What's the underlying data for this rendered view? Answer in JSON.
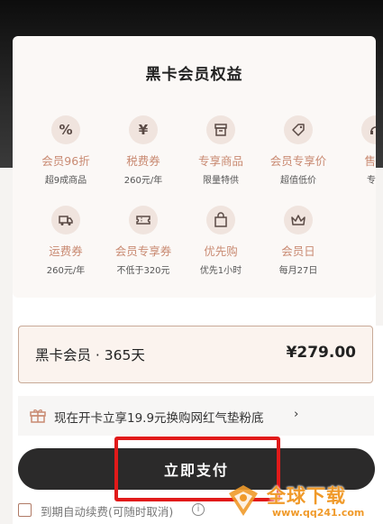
{
  "card": {
    "title": "黑卡会员权益",
    "benefits_row1": [
      {
        "icon": "percent-icon",
        "glyph": "%",
        "name": "会员96折",
        "sub": "超9成商品"
      },
      {
        "icon": "yen-icon",
        "glyph": "¥",
        "name": "税费券",
        "sub": "260元/年"
      },
      {
        "icon": "box-icon",
        "name": "专享商品",
        "sub": "限量特供"
      },
      {
        "icon": "tag-icon",
        "name": "会员专享价",
        "sub": "超值低价"
      },
      {
        "icon": "service-icon",
        "name": "售后",
        "sub": "专属"
      }
    ],
    "benefits_row2": [
      {
        "icon": "truck-icon",
        "name": "运费券",
        "sub": "260元/年"
      },
      {
        "icon": "ticket-icon",
        "name": "会员专享券",
        "sub": "不低于320元"
      },
      {
        "icon": "bag-icon",
        "name": "优先购",
        "sub": "优先1小时"
      },
      {
        "icon": "crown-icon",
        "name": "会员日",
        "sub": "每月27日"
      }
    ]
  },
  "plan": {
    "name": "黑卡会员 · 365天",
    "price": "¥279.00"
  },
  "promo": {
    "text": "现在开卡立享19.9元换购网红气垫粉底",
    "chevron": "›"
  },
  "pay_button": {
    "label": "立即支付"
  },
  "auto_renew": {
    "label": "到期自动续费(可随时取消)",
    "info_glyph": "i"
  },
  "watermark": {
    "title": "全球下载",
    "url": "www.qq241.com"
  },
  "colors": {
    "accent": "#c98a72",
    "button": "#2b2a2a",
    "highlight": "#e11a1a",
    "watermark": "#f09a2a"
  }
}
